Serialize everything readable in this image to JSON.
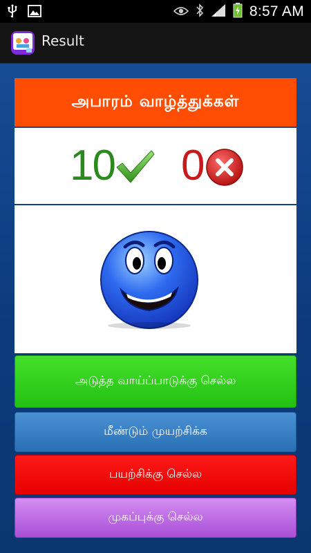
{
  "status_bar": {
    "time": "8:57 AM",
    "icons": [
      "usb-icon",
      "image-icon",
      "eye-icon",
      "bluetooth-icon",
      "signal-icon",
      "battery-charging-icon"
    ]
  },
  "app_bar": {
    "title": "Result",
    "icon": "app-logo-icon"
  },
  "result": {
    "banner_text": "அபாரம் வாழ்த்துக்கள்",
    "correct_count": "10",
    "wrong_count": "0",
    "correct_icon": "check-icon",
    "wrong_icon": "cross-icon",
    "face_icon": "smiley-face-icon"
  },
  "buttons": {
    "next_label": "அடுத்த வாய்ப்பாடுக்கு செல்ல",
    "retry_label": "மீண்டும் முயற்சிக்க",
    "practice_label": "பயற்சிக்கு செல்ல",
    "home_label": "முகப்புக்கு செல்ல"
  },
  "colors": {
    "banner": "#ff4e04",
    "next_button": "#2ed11a",
    "retry_button": "#3a80c4",
    "practice_button": "#f20707",
    "home_button": "#bd6ae3",
    "correct_number": "#2a8a1d",
    "wrong_number": "#c81a1a"
  }
}
